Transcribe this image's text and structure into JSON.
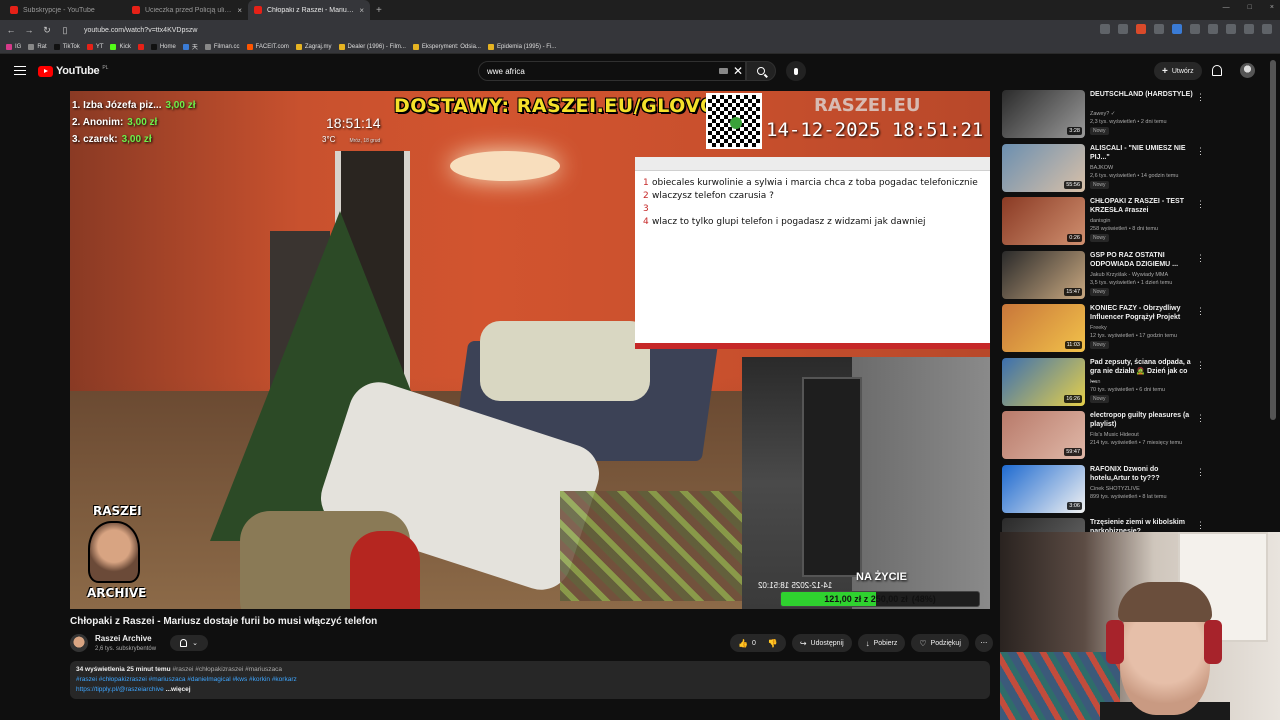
{
  "browser": {
    "tabs": [
      {
        "title": "Subskrypcje - YouTube",
        "active": false
      },
      {
        "title": "Ucieczka przed Policją ulicami Wars...",
        "active": false
      },
      {
        "title": "Chłopaki z Raszei - Mariusz d...",
        "active": true
      }
    ],
    "new_tab": "+",
    "url": "youtube.com/watch?v=ttx4KVDpszw",
    "bookmarks": [
      "IG",
      "Rat",
      "TikTok",
      "YT",
      "Kick",
      "Home",
      "天",
      "Filman.cc",
      "FACEIT.com",
      "Zagraj.my",
      "Dealer (1996) - Film...",
      "Eksperyment: Odsia...",
      "Epidemia (1995) - Fi..."
    ]
  },
  "youtube": {
    "logo": "YouTube",
    "logo_country": "PL",
    "search_value": "wwe africa",
    "create_label": "Utwórz"
  },
  "player": {
    "donors": [
      {
        "name": "1. Izba Józefa piz...",
        "amount": "3,00 zł"
      },
      {
        "name": "2. Anonim:",
        "amount": "3,00 zł"
      },
      {
        "name": "3. czarek:",
        "amount": "3,00 zł"
      }
    ],
    "banner": "DOSTAWY: RASZEI.EU/GLOVO",
    "brand": "RASZEI.EU",
    "stamp": "14-12-2025 18:51:21",
    "clock": "18:51:14",
    "temperature": "3°C",
    "weather_sub": "Mróz, 18 grud",
    "notepad_lines": [
      {
        "n": "1",
        "text": "obiecales kurwolinie a sylwia i marcia chca z toba pogadac telefonicznie"
      },
      {
        "n": "2",
        "text": "wlaczysz telefon czarusia ?"
      },
      {
        "n": "3",
        "text": ""
      },
      {
        "n": "4",
        "text": "wlacz to tylko glupi telefon i pogadasz z widzami jak dawniej"
      }
    ],
    "cam_time": "14-12-2025 18:51:02",
    "goal_label": "NA ŻYCIE",
    "goal_text": "121,00 zł z 250,00 zł",
    "goal_pct_text": "(48%)",
    "goal_fraction": 0.48,
    "archive_top": "RASZEI",
    "archive_bottom": "ARCHIVE"
  },
  "video": {
    "title": "Chłopaki z Raszei - Mariusz dostaje furii bo musi włączyć telefon",
    "channel": "Raszei Archive",
    "subscribers": "2,6 tys. subskrybentów",
    "likes": "0",
    "share_label": "Udostępnij",
    "download_label": "Pobierz",
    "thanks_label": "Podziękuj",
    "description": {
      "meta": "34 wyświetlenia  25 minut temu",
      "tags_line": "#raszei #chłopakizraszei #mariuszaca",
      "tags_line2": "#raszei #chłopakizraszei #mariuszaca #danielmagical #kws #korkin #korkarz",
      "link": "https://tipply.pl/@raszeiarchive",
      "more": "...więcej"
    }
  },
  "recommendations": [
    {
      "title": "DEUTSCHLAND (HARDSTYLE)",
      "channel": "Zawey? ✓",
      "meta": "2,3 tys. wyświetleń • 2 dni temu",
      "badge": "Nowy",
      "duration": "3:28",
      "colors": [
        "#2b2b2b",
        "#9a9a9a"
      ]
    },
    {
      "title": "ALISCALI - \"NIE UMIESZ NIE PIJ...\"",
      "channel": "BAJKOW",
      "meta": "2,6 tys. wyświetleń • 14 godzin temu",
      "badge": "Nowy",
      "duration": "55:56",
      "colors": [
        "#6b8fb0",
        "#d8c0a8"
      ]
    },
    {
      "title": "CHŁOPAKI Z RASZEI - TEST KRZESŁA #raszei",
      "channel": "danisgin",
      "meta": "258 wyświetleń • 8 dni temu",
      "badge": "Nowy",
      "duration": "0:26",
      "colors": [
        "#8a3a24",
        "#d09070"
      ]
    },
    {
      "title": "GSP PO RAZ OSTATNI ODPOWIADA DZIGIEMU ...",
      "channel": "Jakub Krzyślak - Wywiady MMA",
      "meta": "3,5 tys. wyświetleń • 1 dzień temu",
      "badge": "Nowy",
      "duration": "15:47",
      "colors": [
        "#2a2a2a",
        "#c9a880"
      ]
    },
    {
      "title": "KONIEC FAZY - Obrzydliwy Influencer Pogrążył Projekt",
      "channel": "Freeky",
      "meta": "12 tys. wyświetleń • 17 godzin temu",
      "badge": "Nowy",
      "duration": "11:03",
      "colors": [
        "#c8763a",
        "#f2c24a"
      ]
    },
    {
      "title": "Pad zepsuty, ściana odpada, a gra nie działa 🧟 Dzień jak co ...",
      "channel": "Ivan",
      "meta": "70 tys. wyświetleń • 6 dni temu",
      "badge": "Nowy",
      "duration": "16:26",
      "colors": [
        "#3b6fb0",
        "#e6d04a"
      ]
    },
    {
      "title": "electropop guilty pleasures (a playlist)",
      "channel": "Fils's Music Hideout",
      "meta": "214 tys. wyświetleń • 7 miesięcy temu",
      "badge": "",
      "duration": "59:47",
      "colors": [
        "#b87a6a",
        "#e0b8a8"
      ]
    },
    {
      "title": "RAFONIX Dzwoni do hotelu,Artur to ty???",
      "channel": "Cinek SHOTYZLIVE",
      "meta": "899 tys. wyświetleń • 8 lat temu",
      "badge": "",
      "duration": "3:06",
      "colors": [
        "#1e6ad0",
        "#f2f2f2"
      ]
    },
    {
      "title": "Trzęsienie ziemi w kibolskim narkobiznesie?",
      "channel": "",
      "meta": "",
      "badge": "",
      "duration": "",
      "colors": [
        "#2a2a2a",
        "#6a6a6a"
      ]
    }
  ]
}
